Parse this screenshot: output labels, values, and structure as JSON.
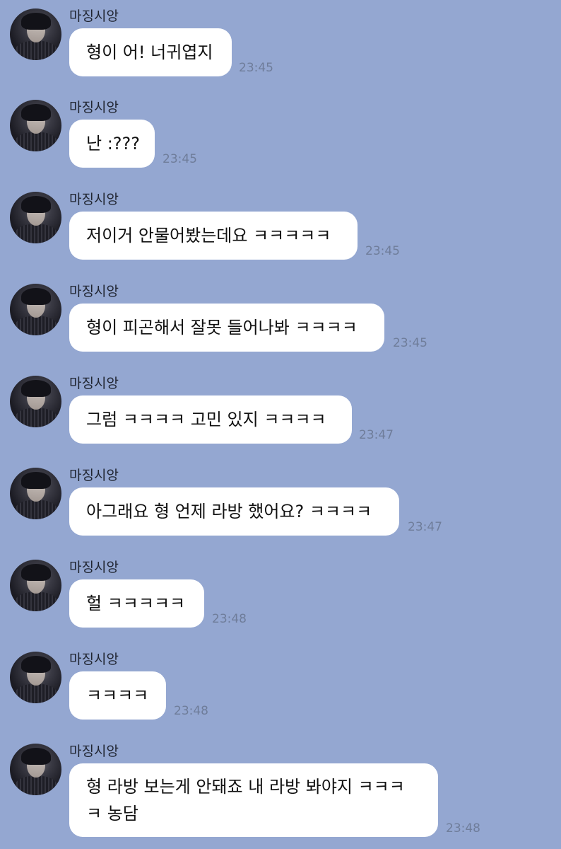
{
  "colors": {
    "background": "#94a7d1",
    "bubble": "#ffffff",
    "time_text": "#6f7d9a"
  },
  "messages": [
    {
      "sender": "마징시앙",
      "text": "형이 어! 너귀엽지",
      "time": "23:45"
    },
    {
      "sender": "마징시앙",
      "text": "난 :???",
      "time": "23:45"
    },
    {
      "sender": "마징시앙",
      "text": "저이거 안물어봤는데요 ㅋㅋㅋㅋㅋ",
      "time": "23:45"
    },
    {
      "sender": "마징시앙",
      "text": "형이 피곤해서 잘못 들어나봐 ㅋㅋㅋㅋ",
      "time": "23:45"
    },
    {
      "sender": "마징시앙",
      "text": "그럼 ㅋㅋㅋㅋ 고민 있지 ㅋㅋㅋㅋ",
      "time": "23:47"
    },
    {
      "sender": "마징시앙",
      "text": "아그래요 형 언제 라방 했어요? ㅋㅋㅋㅋ",
      "time": "23:47"
    },
    {
      "sender": "마징시앙",
      "text": "헐 ㅋㅋㅋㅋㅋ",
      "time": "23:48"
    },
    {
      "sender": "마징시앙",
      "text": "ㅋㅋㅋㅋ",
      "time": "23:48"
    },
    {
      "sender": "마징시앙",
      "text_lines": [
        "형 라방 보는게 안돼죠 내 라방 봐야지 ㅋㅋㅋ",
        "ㅋ 농담"
      ],
      "time": "23:48"
    }
  ]
}
